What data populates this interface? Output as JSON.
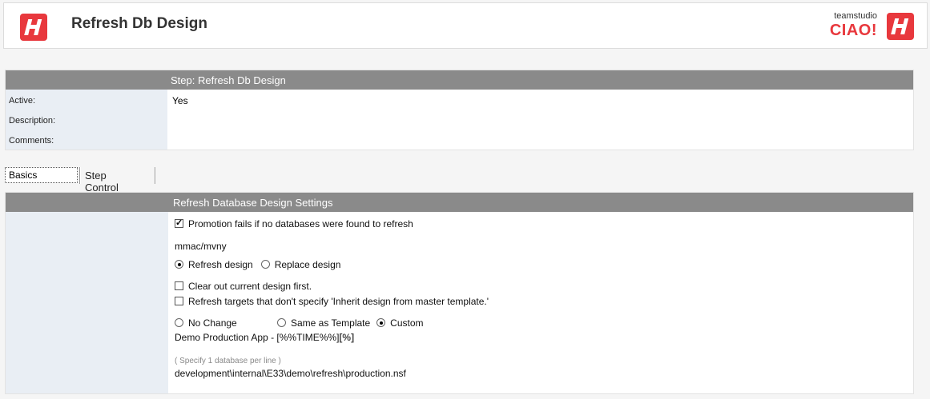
{
  "header": {
    "title": "Refresh Db Design",
    "brand_small": "teamstudio",
    "brand_big": "CIAO!",
    "logo_icon": "teamstudio-logo-icon",
    "accent_color": "#e8383d"
  },
  "step": {
    "heading": "Step:  Refresh Db Design",
    "rows": [
      {
        "label": "Active:",
        "value": "Yes"
      },
      {
        "label": "Description:",
        "value": ""
      },
      {
        "label": "Comments:",
        "value": ""
      }
    ]
  },
  "tabs": [
    {
      "label": "Basics",
      "active": true
    },
    {
      "label": "Step Control",
      "active": false
    }
  ],
  "settings": {
    "heading": "Refresh Database Design Settings",
    "promotion_fails": {
      "label": "Promotion fails if no databases were found to refresh",
      "checked": true
    },
    "server": "mmac/mvny",
    "mode": {
      "refresh_label": "Refresh design",
      "replace_label": "Replace design",
      "selected": "refresh"
    },
    "clear_out": {
      "label": "Clear out current design first.",
      "checked": false
    },
    "refresh_targets": {
      "label": "Refresh targets that don't specify 'Inherit design from master template.'",
      "checked": false
    },
    "title_option": {
      "no_change_label": "No Change",
      "same_label": "Same as Template",
      "custom_label": "Custom",
      "selected": "custom"
    },
    "custom_title": "Demo Production App - [%%TIME%%]",
    "percent_button": "[%]",
    "hint": "( Specify 1 database per line )",
    "database_path": "development\\internal\\E33\\demo\\refresh\\production.nsf"
  }
}
